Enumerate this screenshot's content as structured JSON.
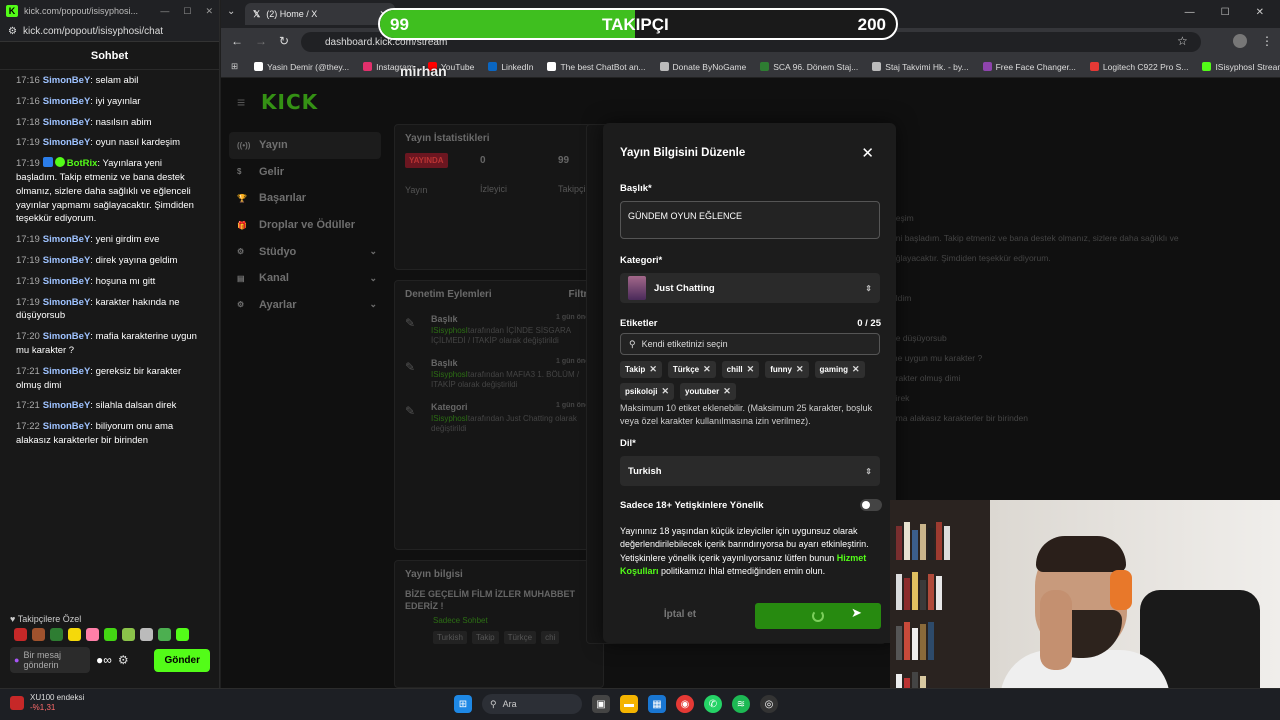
{
  "chat_window": {
    "tab_title": "kick.com/popout/isisyphosi...",
    "url": "kick.com/popout/isisyphosi/chat",
    "header": "Sohbet",
    "messages": [
      {
        "time": "17:16",
        "user": "SimonBeY",
        "text": "selam abil"
      },
      {
        "time": "17:16",
        "user": "SimonBeY",
        "text": "iyi yayınlar"
      },
      {
        "time": "17:18",
        "user": "SimonBeY",
        "text": "nasılsın abim"
      },
      {
        "time": "17:19",
        "user": "SimonBeY",
        "text": "oyun nasıl kardeşim"
      },
      {
        "time": "17:19",
        "user": "BotRix",
        "bot": true,
        "text": "Yayınlara yeni başladım. Takip etmeniz ve bana destek olmanız, sizlere daha sağlıklı ve eğlenceli yayınlar yapmamı sağlayacaktır. Şimdiden teşekkür ediyorum."
      },
      {
        "time": "17:19",
        "user": "SimonBeY",
        "text": "yeni girdim eve"
      },
      {
        "time": "17:19",
        "user": "SimonBeY",
        "text": "direk yayına geldim"
      },
      {
        "time": "17:19",
        "user": "SimonBeY",
        "text": "hoşuna mı gitt"
      },
      {
        "time": "17:19",
        "user": "SimonBeY",
        "text": "karakter hakında ne düşüyorsub"
      },
      {
        "time": "17:20",
        "user": "SimonBeY",
        "text": "mafia karakterine uygun mu karakter ?"
      },
      {
        "time": "17:21",
        "user": "SimonBeY",
        "text": "gereksiz bir karakter olmuş dimi"
      },
      {
        "time": "17:21",
        "user": "SimonBeY",
        "text": "silahla dalsan direk"
      },
      {
        "time": "17:22",
        "user": "SimonBeY",
        "text": "biliyorum onu ama alakasız karakterler bir birinden"
      }
    ],
    "followers_only_label": "Takipçilere Özel",
    "input_placeholder": "Bir mesaj gönderin",
    "send_label": "Gönder"
  },
  "browser": {
    "tab_title": "(2) Home / X",
    "url": "dashboard.kick.com/stream",
    "bookmarks": [
      {
        "label": "Yasin Demir (@they...",
        "color": "#ffffff"
      },
      {
        "label": "Instagram",
        "color": "#e1306c"
      },
      {
        "label": "YouTube",
        "color": "#ff0000"
      },
      {
        "label": "LinkedIn",
        "color": "#0a66c2"
      },
      {
        "label": "The best ChatBot an...",
        "color": "#ffffff"
      },
      {
        "label": "Donate ByNoGame",
        "color": "#bbbbbb"
      },
      {
        "label": "SCA 96. Dönem Staj...",
        "color": "#2e7d32"
      },
      {
        "label": "Staj Takvimi Hk. - by...",
        "color": "#bbbbbb"
      },
      {
        "label": "Free Face Changer...",
        "color": "#8e44ad"
      },
      {
        "label": "Logitech C922 Pro S...",
        "color": "#e53935"
      },
      {
        "label": "ISisyphosI Stream -...",
        "color": "#53fc18"
      }
    ]
  },
  "goal": {
    "current": "99",
    "label": "TAKIPÇI",
    "target": "200",
    "progress": 0.495
  },
  "overlay_name": "mirhan",
  "dashboard": {
    "logo": "KICK",
    "nav": [
      {
        "label": "Yayın",
        "active": true
      },
      {
        "label": "Gelir"
      },
      {
        "label": "Başarılar"
      },
      {
        "label": "Droplar ve Ödüller"
      },
      {
        "label": "Stüdyo",
        "chevron": true
      },
      {
        "label": "Kanal",
        "chevron": true
      },
      {
        "label": "Ayarlar",
        "chevron": true
      }
    ],
    "stats_title": "Yayın İstatistikleri",
    "live_badge": "YAYINDA",
    "stat_viewers_value": "0",
    "stat_viewers_label": "İzleyici",
    "stat_followers_value": "99",
    "stat_followers_label": "Takipçi",
    "stat_stream_label": "Yayın",
    "moderation_title": "Denetim Eylemleri",
    "filter_label": "Filtre",
    "mod_items": [
      {
        "title": "Başlık",
        "time": "1 gün önce",
        "user": "ISisyphosI",
        "rest": "tarafından İÇİNDE SİSGARA İÇİLMEDİ / ITAKİP olarak değiştirildi"
      },
      {
        "title": "Başlık",
        "time": "1 gün önce",
        "user": "ISisyphosI",
        "rest": "tarafından MAFIA3 1. BÖLÜM / ITAKİP olarak değiştirildi"
      },
      {
        "title": "Kategori",
        "time": "1 gün önce",
        "user": "ISisyphosI",
        "rest": "tarafından Just Chatting olarak değiştirildi"
      }
    ],
    "info_title": "Yayın bilgisi",
    "info_stream_title": "BİZE GEÇELİM FİLM İZLER MUHABBET EDERİZ !",
    "info_category": "Sadece Sohbet",
    "info_tags": [
      "Turkish",
      "Takip",
      "Türkçe",
      "chi"
    ],
    "chat_mirror": [
      "deşim",
      "eni başladım. Takip etmeniz ve bana destek olmanız, sizlere daha sağlıklı ve",
      "ağlayacaktır. Şimdiden teşekkür ediyorum.",
      "",
      "eldim",
      "",
      "ne düşüyorsub",
      "ine uygun mu karakter ?",
      "arakter olmuş dimi",
      "direk",
      "ama alakasız karakterler bir birinden"
    ]
  },
  "modal": {
    "title": "Yayın Bilgisini Düzenle",
    "title_label": "Başlık*",
    "title_value": "GÜNDEM OYUN EĞLENCE",
    "category_label": "Kategori*",
    "category_value": "Just Chatting",
    "tags_label": "Etiketler",
    "tags_count": "0 / 25",
    "tags_placeholder": "Kendi etiketinizi seçin",
    "tags": [
      "Takip",
      "Türkçe",
      "chill",
      "funny",
      "gaming",
      "psikoloji",
      "youtuber"
    ],
    "tags_help": "Maksimum 10 etiket eklenebilir. (Maksimum 25 karakter, boşluk veya özel karakter kullanılmasına izin verilmez).",
    "language_label": "Dil*",
    "language_value": "Turkish",
    "adult_label": "Sadece 18+ Yetişkinlere Yönelik",
    "adult_text_pre": "Yayınınız 18 yaşından küçük izleyiciler için uygunsuz olarak değerlendirilebilecek içerik barındırıyorsa bu ayarı etkinleştirin. Yetişkinlere yönelik içerik yayınlıyorsanız lütfen bunun ",
    "adult_text_link": "Hizmet Koşulları",
    "adult_text_post": " politikamızı ihlal etmediğinden emin olun.",
    "cancel_label": "İptal et"
  },
  "taskbar": {
    "widget_title": "XU100 endeksi",
    "widget_change": "-%1,31",
    "search_label": "Ara"
  },
  "colors": {
    "kick_green": "#53fc18",
    "goal_green": "#3fbf1f",
    "bg": "#141414"
  }
}
